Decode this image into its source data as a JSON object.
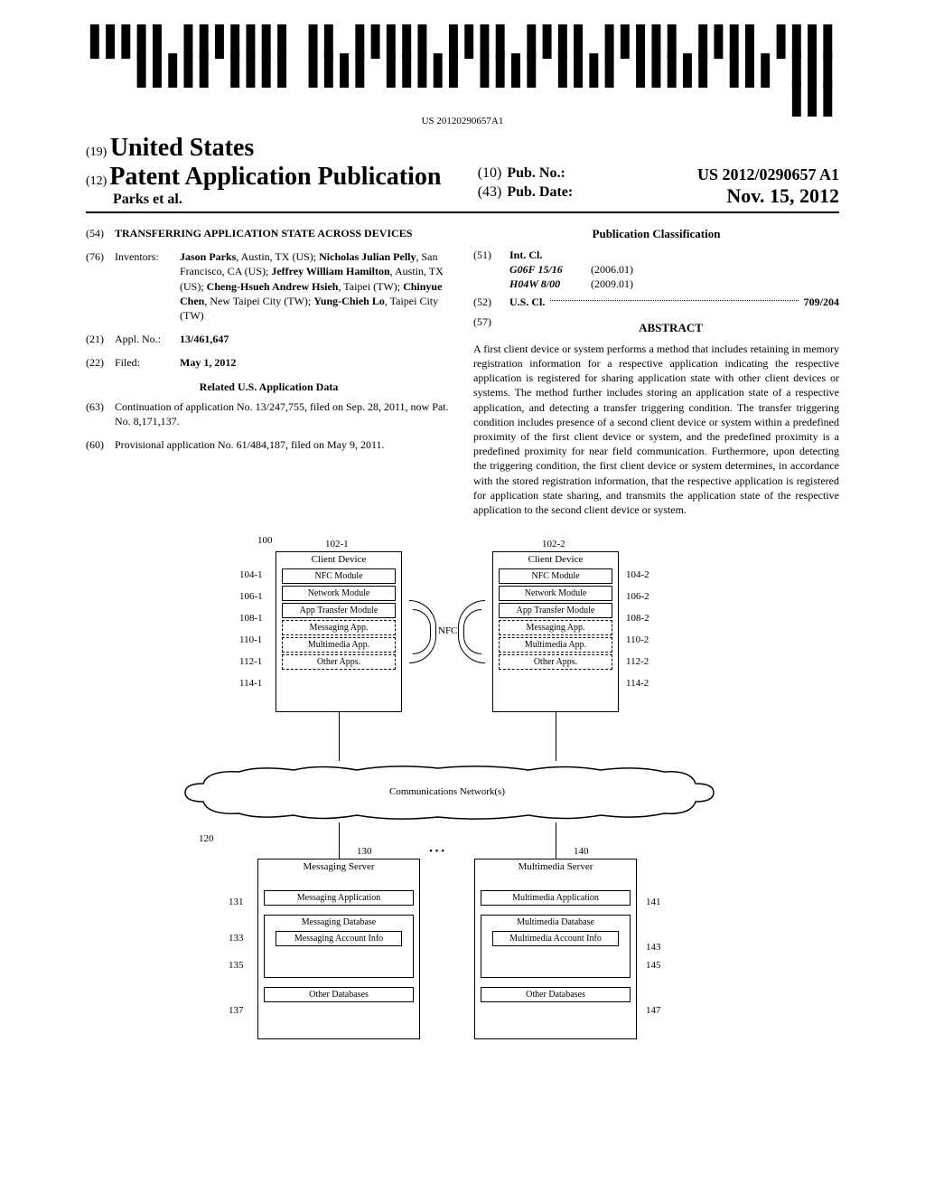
{
  "barcode_text": "US 20120290657A1",
  "country_prefix": "(19)",
  "country": "United States",
  "pub_prefix": "(12)",
  "pub_title": "Patent Application Publication",
  "authors": "Parks et al.",
  "pub_no_prefix": "(10)",
  "pub_no_label": "Pub. No.:",
  "pub_no": "US 2012/0290657 A1",
  "pub_date_prefix": "(43)",
  "pub_date_label": "Pub. Date:",
  "pub_date": "Nov. 15, 2012",
  "title_num": "(54)",
  "title": "TRANSFERRING APPLICATION STATE ACROSS DEVICES",
  "inventors_num": "(76)",
  "inventors_label": "Inventors:",
  "inventors_val": "Jason Parks, Austin, TX (US); Nicholas Julian Pelly, San Francisco, CA (US); Jeffrey William Hamilton, Austin, TX (US); Cheng-Hsueh Andrew Hsieh, Taipei (TW); Chinyue Chen, New Taipei City (TW); Yung-Chieh Lo, Taipei City (TW)",
  "appl_num_num": "(21)",
  "appl_num_label": "Appl. No.:",
  "appl_num_val": "13/461,647",
  "filed_num": "(22)",
  "filed_label": "Filed:",
  "filed_val": "May 1, 2012",
  "related_title": "Related U.S. Application Data",
  "cont_num": "(63)",
  "cont_val": "Continuation of application No. 13/247,755, filed on Sep. 28, 2011, now Pat. No. 8,171,137.",
  "prov_num": "(60)",
  "prov_val": "Provisional application No. 61/484,187, filed on May 9, 2011.",
  "classification_title": "Publication Classification",
  "intcl_num": "(51)",
  "intcl_label": "Int. Cl.",
  "intcl_items": [
    {
      "code": "G06F 15/16",
      "year": "(2006.01)"
    },
    {
      "code": "H04W 8/00",
      "year": "(2009.01)"
    }
  ],
  "uscl_num": "(52)",
  "uscl_label": "U.S. Cl.",
  "uscl_val": "709/204",
  "abstract_num": "(57)",
  "abstract_title": "ABSTRACT",
  "abstract_text": "A first client device or system performs a method that includes retaining in memory registration information for a respective application indicating the respective application is registered for sharing application state with other client devices or systems. The method further includes storing an application state of a respective application, and detecting a transfer triggering condition. The transfer triggering condition includes presence of a second client device or system within a predefined proximity of the first client device or system, and the predefined proximity is a predefined proximity for near field communication. Furthermore, upon detecting the triggering condition, the first client device or system determines, in accordance with the stored registration information, that the respective application is registered for application state sharing, and transmits the application state of the respective application to the second client device or system.",
  "figure": {
    "ref_100": "100",
    "ref_102_1": "102-1",
    "ref_102_2": "102-2",
    "client_device": "Client Device",
    "ref_104_1": "104-1",
    "ref_104_2": "104-2",
    "nfc_module": "NFC Module",
    "ref_106_1": "106-1",
    "ref_106_2": "106-2",
    "network_module": "Network Module",
    "ref_108_1": "108-1",
    "ref_108_2": "108-2",
    "app_transfer": "App Transfer Module",
    "ref_110_1": "110-1",
    "ref_110_2": "110-2",
    "messaging_app": "Messaging App.",
    "ref_112_1": "112-1",
    "ref_112_2": "112-2",
    "multimedia_app": "Multimedia App.",
    "ref_114_1": "114-1",
    "ref_114_2": "114-2",
    "other_apps": "Other Apps.",
    "nfc": "NFC",
    "comm_net": "Communications Network(s)",
    "ref_120": "120",
    "ref_130": "130",
    "ref_140": "140",
    "dots": "• • •",
    "messaging_server": "Messaging Server",
    "multimedia_server": "Multimedia Server",
    "ref_131": "131",
    "ref_141": "141",
    "messaging_application": "Messaging Application",
    "multimedia_application": "Multimedia Application",
    "ref_133": "133",
    "ref_143": "143",
    "messaging_database": "Messaging Database",
    "multimedia_database": "Multimedia Database",
    "ref_135": "135",
    "ref_145": "145",
    "messaging_account": "Messaging Account Info",
    "multimedia_account": "Multimedia Account Info",
    "ref_137": "137",
    "ref_147": "147",
    "other_databases": "Other Databases"
  }
}
